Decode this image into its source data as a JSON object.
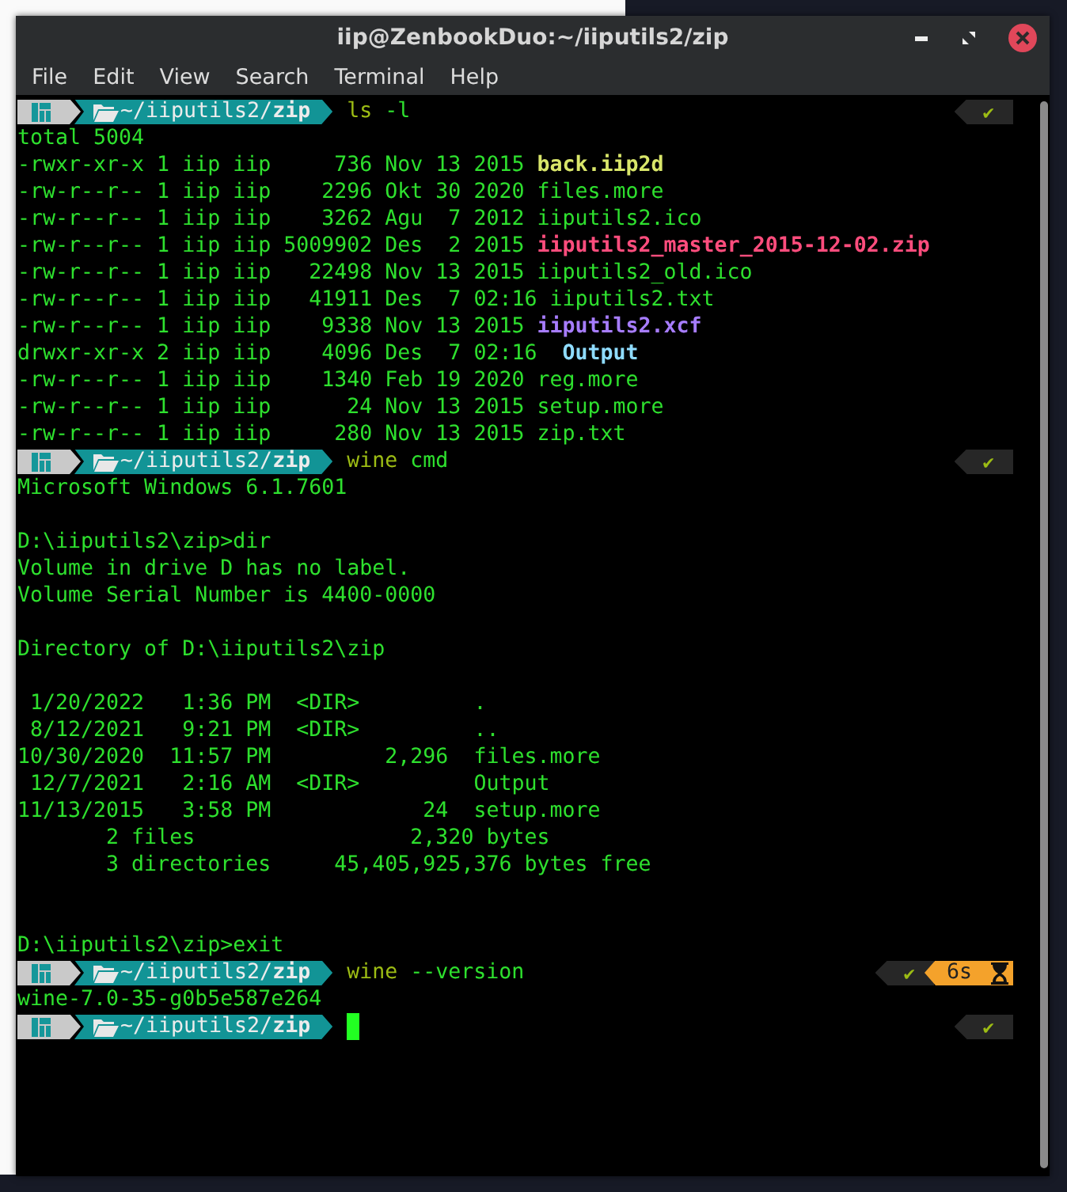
{
  "window": {
    "title": "iip@ZenbookDuo:~/iiputils2/zip"
  },
  "menu": [
    "File",
    "Edit",
    "View",
    "Search",
    "Terminal",
    "Help"
  ],
  "lines": [
    {
      "kind": "prompt",
      "path": "~/iiputils2/**zip**",
      "command": "ls",
      "args": "-l",
      "status": "✔",
      "cursor": false
    },
    {
      "kind": "output",
      "segments": [
        {
          "text": "total 5004",
          "kind": "plain"
        }
      ]
    },
    {
      "kind": "output",
      "segments": [
        {
          "text": "-rwxr-xr-x 1 iip iip     736 Nov 13 2015 ",
          "kind": "plain"
        },
        {
          "text": "back.iip2d",
          "kind": "exec"
        }
      ]
    },
    {
      "kind": "output",
      "segments": [
        {
          "text": "-rw-r--r-- 1 iip iip    2296 Okt 30 2020 files.more",
          "kind": "plain"
        }
      ]
    },
    {
      "kind": "output",
      "segments": [
        {
          "text": "-rw-r--r-- 1 iip iip    3262 Agu  7 2012 iiputils2.ico",
          "kind": "plain"
        }
      ]
    },
    {
      "kind": "output",
      "segments": [
        {
          "text": "-rw-r--r-- 1 iip iip 5009902 Des  2 2015 ",
          "kind": "plain"
        },
        {
          "text": "iiputils2_master_2015-12-02.zip",
          "kind": "archive"
        }
      ]
    },
    {
      "kind": "output",
      "segments": [
        {
          "text": "-rw-r--r-- 1 iip iip   22498 Nov 13 2015 iiputils2_old.ico",
          "kind": "plain"
        }
      ]
    },
    {
      "kind": "output",
      "segments": [
        {
          "text": "-rw-r--r-- 1 iip iip   41911 Des  7 02:16 iiputils2.txt",
          "kind": "plain"
        }
      ]
    },
    {
      "kind": "output",
      "segments": [
        {
          "text": "-rw-r--r-- 1 iip iip    9338 Nov 13 2015 ",
          "kind": "plain"
        },
        {
          "text": "iiputils2.xcf",
          "kind": "image"
        }
      ]
    },
    {
      "kind": "output",
      "segments": [
        {
          "text": "drwxr-xr-x 2 iip iip    4096 Des  7 02:16 ",
          "kind": "plain"
        },
        {
          "text": "Output",
          "kind": "dir"
        }
      ]
    },
    {
      "kind": "output",
      "segments": [
        {
          "text": "-rw-r--r-- 1 iip iip    1340 Feb 19 2020 reg.more",
          "kind": "plain"
        }
      ]
    },
    {
      "kind": "output",
      "segments": [
        {
          "text": "-rw-r--r-- 1 iip iip      24 Nov 13 2015 setup.more",
          "kind": "plain"
        }
      ]
    },
    {
      "kind": "output",
      "segments": [
        {
          "text": "-rw-r--r-- 1 iip iip     280 Nov 13 2015 zip.txt",
          "kind": "plain"
        }
      ]
    },
    {
      "kind": "prompt",
      "path": "~/iiputils2/**zip**",
      "command": "wine",
      "args": "cmd",
      "status": "✔",
      "cursor": false
    },
    {
      "kind": "output",
      "segments": [
        {
          "text": "Microsoft Windows 6.1.7601",
          "kind": "plain"
        }
      ]
    },
    {
      "kind": "blank"
    },
    {
      "kind": "output",
      "segments": [
        {
          "text": "D:\\iiputils2\\zip>dir",
          "kind": "plain"
        }
      ]
    },
    {
      "kind": "output",
      "segments": [
        {
          "text": "Volume in drive D has no label.",
          "kind": "plain"
        }
      ]
    },
    {
      "kind": "output",
      "segments": [
        {
          "text": "Volume Serial Number is 4400-0000",
          "kind": "plain"
        }
      ]
    },
    {
      "kind": "blank"
    },
    {
      "kind": "output",
      "segments": [
        {
          "text": "Directory of D:\\iiputils2\\zip",
          "kind": "plain"
        }
      ]
    },
    {
      "kind": "blank"
    },
    {
      "kind": "output",
      "segments": [
        {
          "text": " 1/20/2022   1:36 PM  <DIR>         .",
          "kind": "plain"
        }
      ]
    },
    {
      "kind": "output",
      "segments": [
        {
          "text": " 8/12/2021   9:21 PM  <DIR>         ..",
          "kind": "plain"
        }
      ]
    },
    {
      "kind": "output",
      "segments": [
        {
          "text": "10/30/2020  11:57 PM         2,296  files.more",
          "kind": "plain"
        }
      ]
    },
    {
      "kind": "output",
      "segments": [
        {
          "text": " 12/7/2021   2:16 AM  <DIR>         Output",
          "kind": "plain"
        }
      ]
    },
    {
      "kind": "output",
      "segments": [
        {
          "text": "11/13/2015   3:58 PM            24  setup.more",
          "kind": "plain"
        }
      ]
    },
    {
      "kind": "output",
      "segments": [
        {
          "text": "       2 files                 2,320 bytes",
          "kind": "plain"
        }
      ]
    },
    {
      "kind": "output",
      "segments": [
        {
          "text": "       3 directories     45,405,925,376 bytes free",
          "kind": "plain"
        }
      ]
    },
    {
      "kind": "blank"
    },
    {
      "kind": "blank"
    },
    {
      "kind": "output",
      "segments": [
        {
          "text": "D:\\iiputils2\\zip>exit",
          "kind": "plain"
        }
      ]
    },
    {
      "kind": "prompt",
      "path": "~/iiputils2/**zip**",
      "command": "wine",
      "args": "--version",
      "status": "✔",
      "duration": "6s",
      "cursor": false
    },
    {
      "kind": "output",
      "segments": [
        {
          "text": "wine-7.0-35-g0b5e587e264",
          "kind": "plain"
        }
      ]
    },
    {
      "kind": "prompt",
      "path": "~/iiputils2/**zip**",
      "status": "✔",
      "cursor": true
    }
  ]
}
